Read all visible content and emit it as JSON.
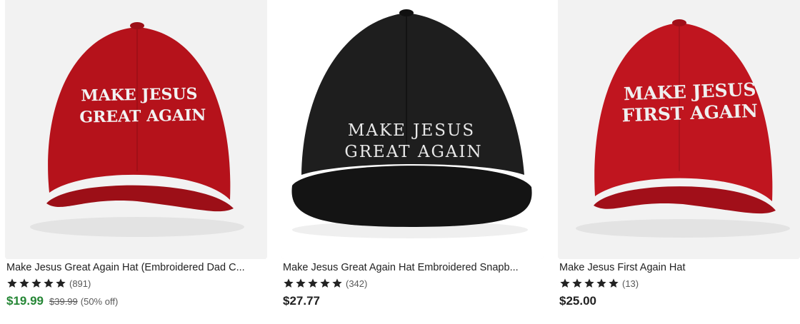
{
  "products": [
    {
      "image_alt": "",
      "hat_color": "#b5121b",
      "embroidery_lines": [
        "MAKE JESUS",
        "GREAT AGAIN"
      ],
      "title": "Make Jesus Great Again Hat (Embroidered Dad C...",
      "stars": 5,
      "rating_count": "(891)",
      "price": "$19.99",
      "original_price": "$39.99",
      "discount": "(50% off)",
      "on_sale": true
    },
    {
      "hat_color": "#1e1e1e",
      "embroidery_lines": [
        "MAKE JESUS",
        "GREAT AGAIN"
      ],
      "title": "Make Jesus Great Again Hat Embroidered Snapb...",
      "stars": 5,
      "rating_count": "(342)",
      "price": "$27.77",
      "on_sale": false
    },
    {
      "hat_color": "#c0151f",
      "embroidery_lines": [
        "MAKE JESUS",
        "FIRST AGAIN"
      ],
      "title": "Make Jesus First Again Hat",
      "stars": 5,
      "rating_count": "(13)",
      "price": "$25.00",
      "on_sale": false
    }
  ],
  "colors": {
    "sale_price": "#258635",
    "text": "#222222",
    "muted": "#595959"
  }
}
